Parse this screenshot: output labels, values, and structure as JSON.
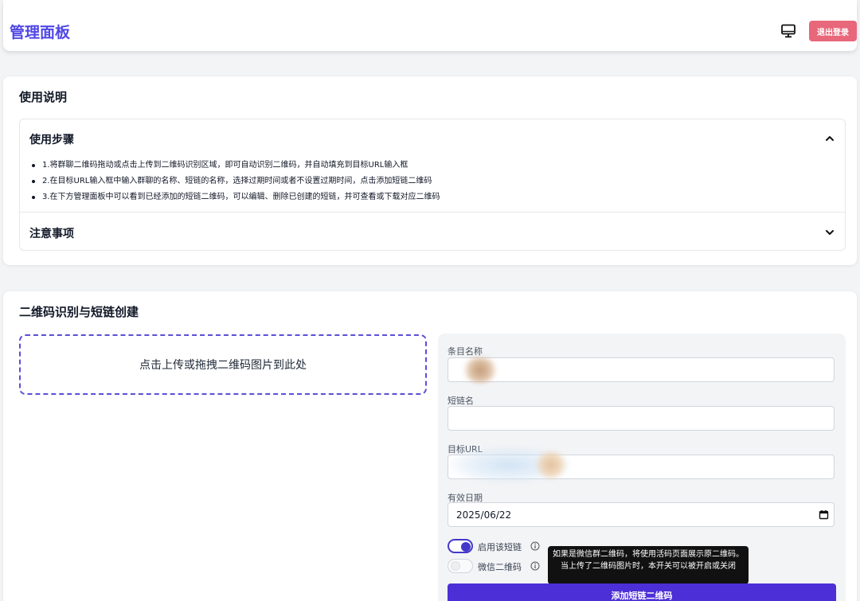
{
  "header": {
    "title": "管理面板",
    "monitor_icon": "monitor-icon",
    "logout_label": "退出登录"
  },
  "instructions": {
    "title": "使用说明",
    "steps_header": "使用步骤",
    "steps": [
      "1.将群聊二维码拖动或点击上传到二维码识别区域，即可自动识别二维码，并自动填充到目标URL输入框",
      "2.在目标URL输入框中输入群聊的名称、短链的名称，选择过期时间或者不设置过期时间，点击添加短链二维码",
      "3.在下方管理面板中可以看到已经添加的短链二维码，可以编辑、删除已创建的短链，并可查看或下载对应二维码"
    ],
    "notes_header": "注意事项",
    "expanded_icon": "chevron-up-icon",
    "collapsed_icon": "chevron-down-icon"
  },
  "create": {
    "title": "二维码识别与短链创建",
    "dropzone_text": "点击上传或拖拽二维码图片到此处",
    "form": {
      "item_name_label": "条目名称",
      "short_name_label": "短链名",
      "target_url_label": "目标URL",
      "expiry_label": "有效日期",
      "expiry_value": "2025/06/22",
      "enable_label": "启用该短链",
      "enable_on": true,
      "wechat_label": "微信二维码",
      "wechat_on": false,
      "tooltip": "如果是微信群二维码，将使用活码页面展示原二维码。当上传了二维码图片时，本开关可以被开启或关闭",
      "submit_label": "添加短链二维码"
    }
  },
  "colors": {
    "brand": "#4f46e5",
    "logout": "#e8677a",
    "submit": "#4c2fd6"
  }
}
